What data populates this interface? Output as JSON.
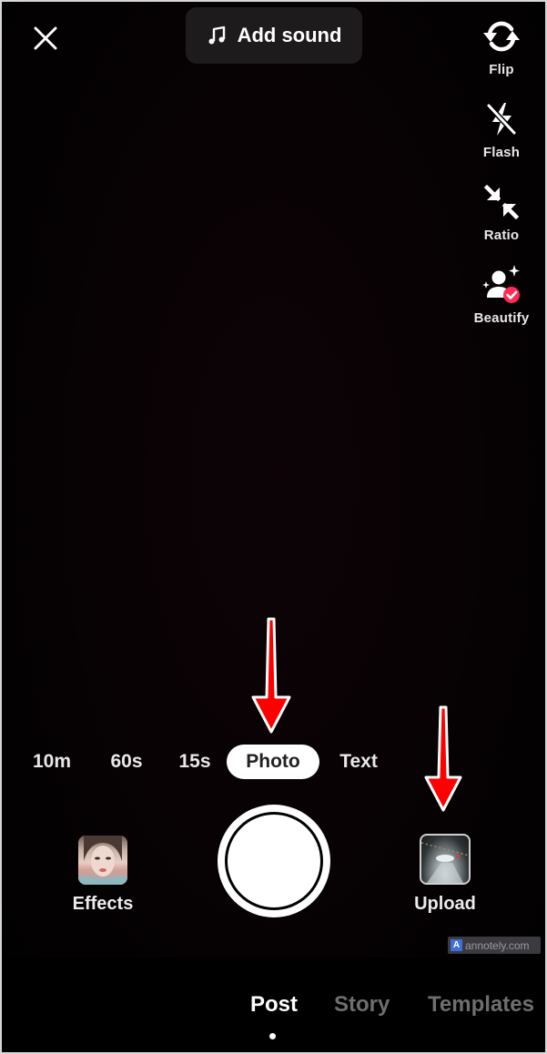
{
  "header": {
    "close_icon": "close-icon",
    "add_sound_label": "Add sound",
    "music_icon": "music-note-icon"
  },
  "side_tools": [
    {
      "label": "Flip",
      "icon": "flip-camera-icon"
    },
    {
      "label": "Flash",
      "icon": "flash-off-icon"
    },
    {
      "label": "Ratio",
      "icon": "ratio-icon"
    },
    {
      "label": "Beautify",
      "icon": "beautify-icon"
    }
  ],
  "capture_modes": {
    "items": [
      "10m",
      "60s",
      "15s",
      "Photo",
      "Text"
    ],
    "selected": "Photo"
  },
  "bottom_controls": {
    "effects_label": "Effects",
    "upload_label": "Upload"
  },
  "watermark": {
    "logo_letter": "A",
    "text": "annotely.com"
  },
  "nav_tabs": {
    "items": [
      "Post",
      "Story",
      "Templates"
    ],
    "active": "Post"
  },
  "annotations": {
    "arrow_color": "#ff0000",
    "targets": [
      "Photo mode",
      "Upload"
    ]
  },
  "colors": {
    "accent_pink": "#fe2c55",
    "background": "#050102"
  }
}
